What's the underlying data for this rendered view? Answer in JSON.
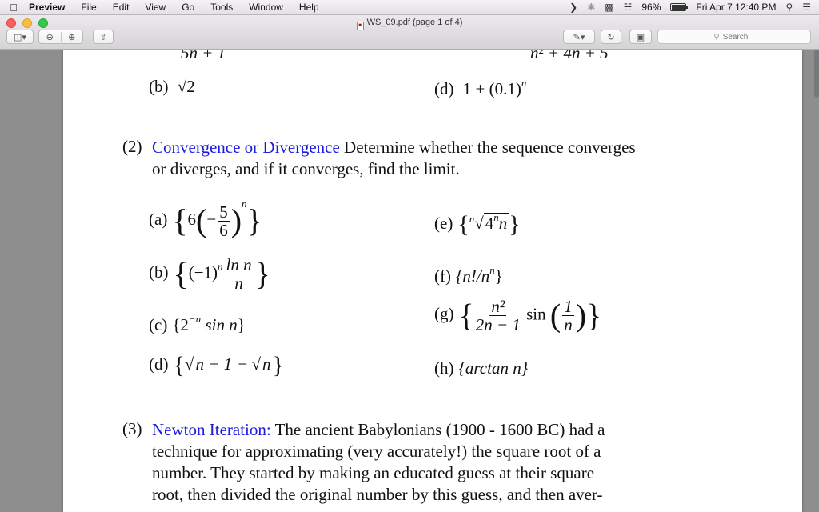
{
  "menubar": {
    "app": "Preview",
    "items": [
      "File",
      "Edit",
      "View",
      "Go",
      "Tools",
      "Window",
      "Help"
    ],
    "battery": "96%",
    "datetime": "Fri Apr 7  12:40 PM"
  },
  "window": {
    "title": "WS_09.pdf (page 1 of 4)",
    "search_placeholder": "Search"
  },
  "document": {
    "prev_line1_left": "5n + 1",
    "prev_line1_right": "n² + 4n + 5",
    "prev_b_label": "(b)",
    "prev_b_expr": "√2",
    "prev_d_label": "(d)",
    "prev_d_expr": "1 + (0.1)",
    "prev_d_sup": "n",
    "s2": {
      "number": "(2)",
      "heading": "Convergence or Divergence",
      "text1": " Determine whether the sequence converges",
      "text2": "or diverges, and if it converges, find the limit.",
      "a_label": "(a)",
      "a_coef": "6",
      "a_num": "5",
      "a_den": "6",
      "a_sup": "n",
      "b_label": "(b)",
      "b_base": "(−1)",
      "b_sup": "n",
      "b_num": "ln n",
      "b_den": "n",
      "c_label": "(c)",
      "c_expr": "2",
      "c_sup": "−n",
      "c_rest": " sin n",
      "d_label": "(d)",
      "d_expr1": "n + 1",
      "d_minus": " − ",
      "d_expr2": "n",
      "e_label": "(e)",
      "e_idx": "n",
      "e_expr": "4",
      "e_sup": "n",
      "e_rest": "n",
      "f_label": "(f)",
      "f_expr": "{n!/n",
      "f_sup": "n",
      "f_close": "}",
      "g_label": "(g)",
      "g_num": "n²",
      "g_den": "2n − 1",
      "g_sin": "sin",
      "g_inum": "1",
      "g_iden": "n",
      "h_label": "(h)",
      "h_expr": "{arctan n}"
    },
    "s3": {
      "number": "(3)",
      "heading": "Newton Iteration:",
      "line1": " The ancient Babylonians (1900 - 1600 BC) had a",
      "line2": "technique for approximating (very accurately!)  the square root of a",
      "line3": "number.  They started by making an educated guess at their square",
      "line4": "root, then divided the original number by this guess, and then aver-"
    }
  }
}
